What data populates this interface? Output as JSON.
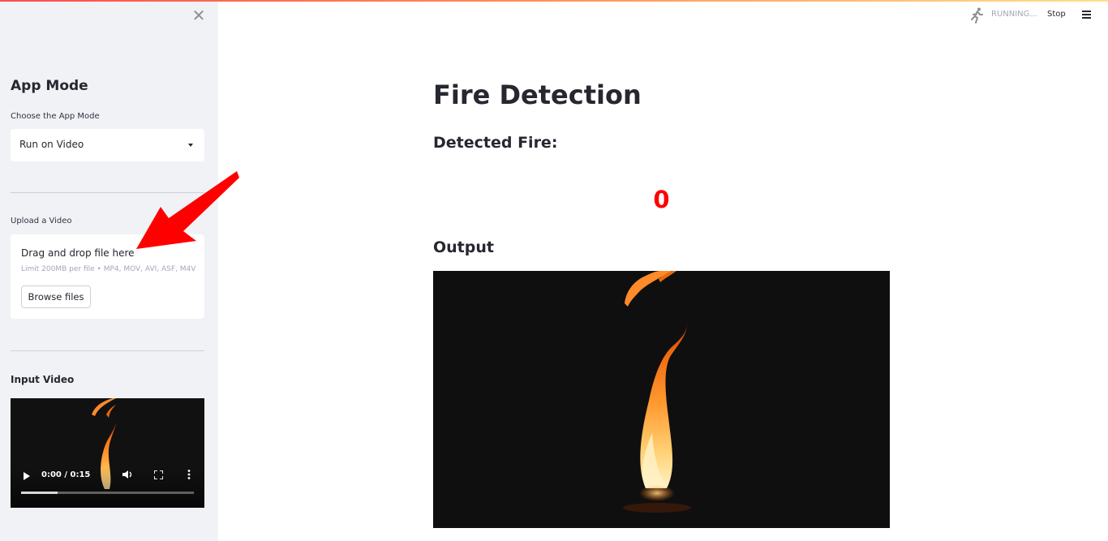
{
  "header": {
    "status_text": "RUNNING...",
    "stop_label": "Stop",
    "running_icon": "running-man-icon",
    "menu_icon": "hamburger-icon"
  },
  "sidebar": {
    "close_icon": "close-icon",
    "title": "App Mode",
    "mode_label": "Choose the App Mode",
    "mode_value": "Run on Video",
    "upload_label": "Upload a Video",
    "drop_text": "Drag and drop file here",
    "limit_text": "Limit 200MB per file • MP4, MOV, AVI, ASF, M4V",
    "browse_label": "Browse files",
    "input_video_title": "Input Video",
    "video": {
      "time": "0:00 / 0:15",
      "progress": 0.21
    }
  },
  "main": {
    "title": "Fire Detection",
    "detected_label": "Detected Fire:",
    "detected_count": "0",
    "output_label": "Output"
  },
  "colors": {
    "accent": "#ff4b4b",
    "count": "#ff0000",
    "sidebar_bg": "#f0f2f6"
  }
}
